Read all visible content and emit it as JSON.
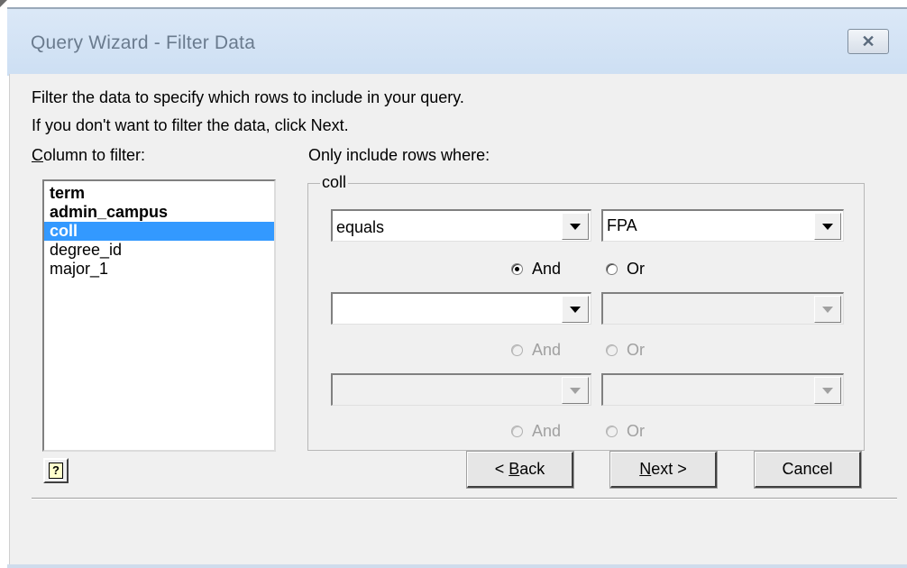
{
  "window": {
    "title": "Query Wizard - Filter Data",
    "close_glyph": "✕"
  },
  "instructions": {
    "line1": "Filter the data to specify which rows to include in your query.",
    "line2": "If you don't want to filter the data, click Next."
  },
  "column_filter": {
    "label_first": "C",
    "label_rest": "olumn to filter:",
    "items": [
      {
        "label": "term",
        "bold": true,
        "selected": false
      },
      {
        "label": "admin_campus",
        "bold": true,
        "selected": false
      },
      {
        "label": "coll",
        "bold": true,
        "selected": true
      },
      {
        "label": "degree_id",
        "bold": false,
        "selected": false
      },
      {
        "label": "major_1",
        "bold": false,
        "selected": false
      }
    ]
  },
  "criteria": {
    "label": "Only include rows where:",
    "group_title": "coll",
    "row1": {
      "operator": "equals",
      "value": "FPA"
    },
    "row2": {
      "operator": "",
      "value": ""
    },
    "row3": {
      "operator": "",
      "value": ""
    },
    "and_label": "And",
    "or_label": "Or"
  },
  "help_button": {
    "glyph": "?"
  },
  "buttons": {
    "back_prefix": "< ",
    "back_key": "B",
    "back_rest": "ack",
    "next_key": "N",
    "next_rest": "ext >",
    "cancel": "Cancel"
  },
  "colors": {
    "selection": "#3399ff",
    "dialog_bg": "#f0f0f0",
    "title_text": "#6a7b8e"
  }
}
